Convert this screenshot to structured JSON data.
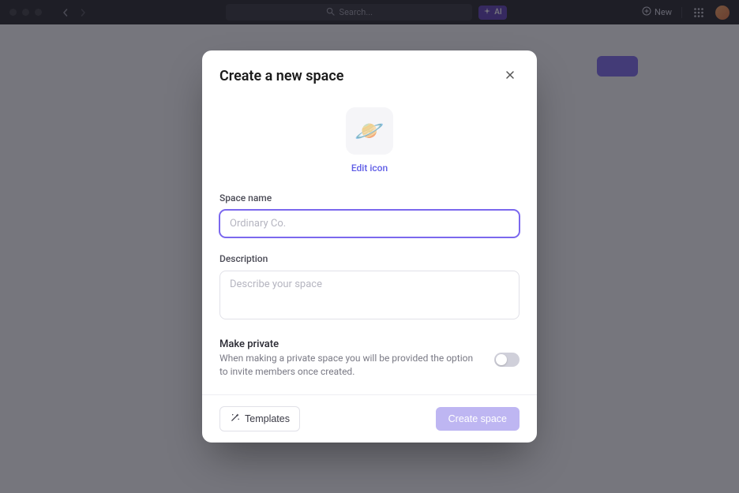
{
  "topbar": {
    "search_placeholder": "Search...",
    "ai_label": "AI",
    "new_label": "New"
  },
  "modal": {
    "title": "Create a new space",
    "icon_emoji": "🪐",
    "edit_icon_label": "Edit icon",
    "space_name_label": "Space name",
    "space_name_placeholder": "Ordinary Co.",
    "description_label": "Description",
    "description_placeholder": "Describe your space",
    "private_title": "Make private",
    "private_desc": "When making a private space you will be provided the option to invite members once created.",
    "templates_label": "Templates",
    "create_label": "Create space"
  },
  "colors": {
    "accent": "#7b68ee",
    "purple_soft": "#beb6f2"
  }
}
